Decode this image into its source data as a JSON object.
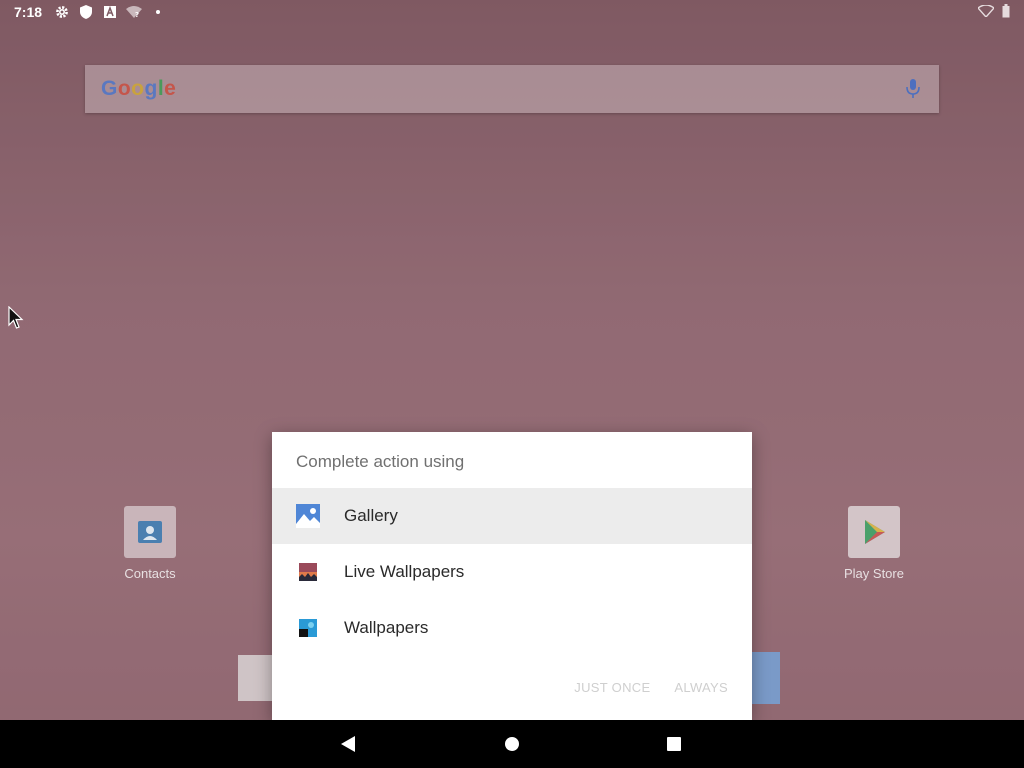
{
  "status_bar": {
    "time": "7:18",
    "icons": [
      "gear-icon",
      "shield-icon",
      "a-letter-icon",
      "wifi-question-icon",
      "dot-icon"
    ],
    "right_icons": [
      "wifi-icon",
      "battery-icon"
    ]
  },
  "search": {
    "logo": "Google",
    "mic_icon": "mic-icon"
  },
  "desktop": {
    "apps": [
      {
        "label": "Contacts",
        "icon": "contacts-icon"
      },
      {
        "label": "Play Store",
        "icon": "play-store-icon"
      }
    ]
  },
  "dialog": {
    "title": "Complete action using",
    "options": [
      {
        "label": "Gallery",
        "icon": "gallery-icon",
        "selected": true
      },
      {
        "label": "Live Wallpapers",
        "icon": "live-wallpapers-icon",
        "selected": false
      },
      {
        "label": "Wallpapers",
        "icon": "wallpapers-icon",
        "selected": false
      }
    ],
    "buttons": {
      "just_once": "JUST ONCE",
      "always": "ALWAYS"
    }
  },
  "colors": {
    "dialog_bg": "#ffffff",
    "selected_row": "#ececec",
    "disabled_button": "#cfcfcf",
    "nav_bar": "#000000"
  }
}
